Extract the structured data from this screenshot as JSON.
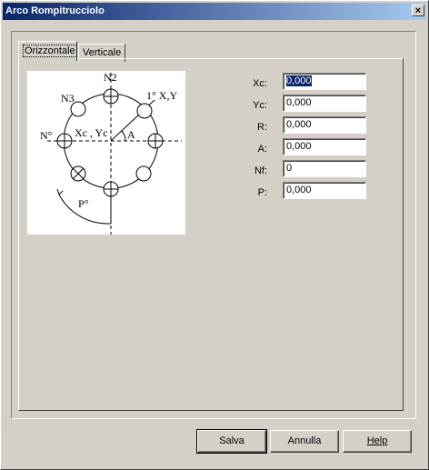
{
  "window": {
    "title": "Arco Rompitrucciolo",
    "close_glyph": "×"
  },
  "tabs": [
    {
      "label": "Orizzontale",
      "active": true
    },
    {
      "label": "Verticale",
      "active": false
    }
  ],
  "diagram": {
    "labels": {
      "n2": "N2",
      "n3": "N3",
      "first": "1° X,Y",
      "nth": "N°",
      "center": "Xc , Yc",
      "angle": "A",
      "pitch": "P°"
    }
  },
  "fields": [
    {
      "label": "Xc:",
      "value": "0,000",
      "selected": true
    },
    {
      "label": "Yc:",
      "value": "0,000"
    },
    {
      "label": "R:",
      "value": "0,000"
    },
    {
      "label": "A:",
      "value": "0,000"
    },
    {
      "label": "Nf:",
      "value": "0"
    },
    {
      "label": "P:",
      "value": "0,000"
    }
  ],
  "buttons": {
    "save": "Salva",
    "cancel": "Annulla",
    "help": "Help"
  }
}
